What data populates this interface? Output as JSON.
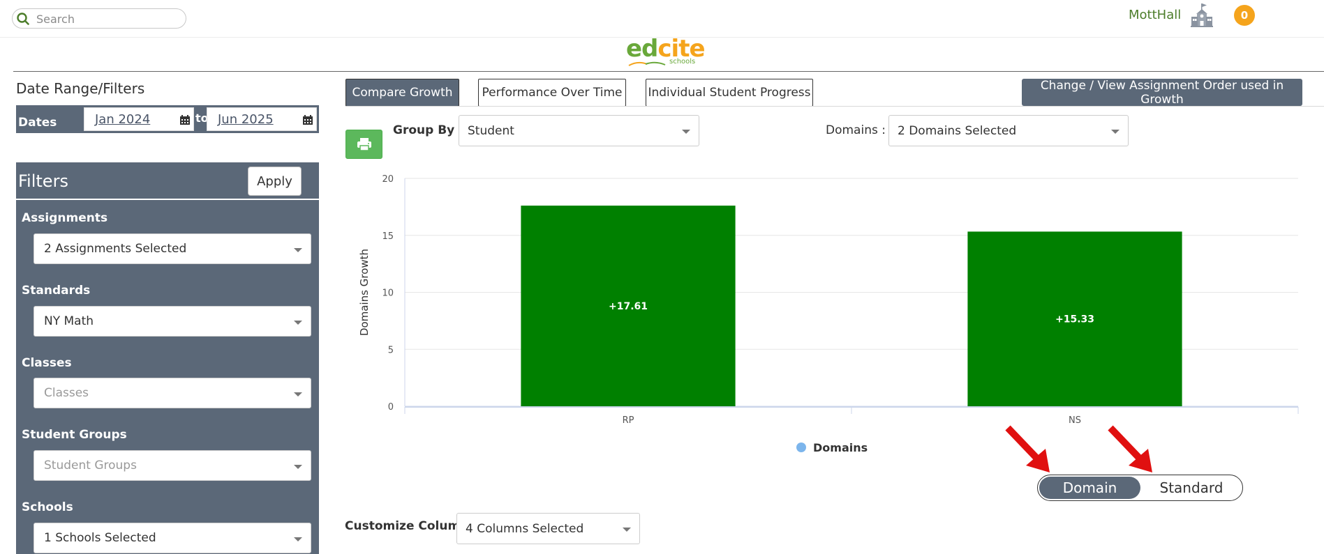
{
  "header": {
    "search_placeholder": "Search",
    "username": "MottHall",
    "notification_count": "0",
    "logo": {
      "word_left": "ed",
      "word_right": "cite",
      "sub": "schools"
    },
    "colors": {
      "brand_green": "#69a83a",
      "brand_orange": "#f5a41c"
    }
  },
  "sidebar": {
    "date_section_title": "Date Range/Filters",
    "dates_label": "Dates",
    "date_from": "Jan 2024",
    "date_to_word": "to",
    "date_to": "Jun 2025",
    "filters_title": "Filters",
    "apply_label": "Apply",
    "filters": [
      {
        "label": "Assignments",
        "value": "2 Assignments Selected",
        "placeholder": false
      },
      {
        "label": "Standards",
        "value": "NY Math",
        "placeholder": false
      },
      {
        "label": "Classes",
        "value": "Classes",
        "placeholder": true
      },
      {
        "label": "Student Groups",
        "value": "Student Groups",
        "placeholder": true
      },
      {
        "label": "Schools",
        "value": "1 Schools Selected",
        "placeholder": false
      }
    ],
    "panel_color": "#5b6878"
  },
  "main": {
    "tabs": [
      {
        "label": "Compare Growth",
        "active": true
      },
      {
        "label": "Performance Over Time",
        "active": false
      },
      {
        "label": "Individual Student Progress",
        "active": false
      }
    ],
    "order_button_label": "Change / View Assignment Order used in Growth",
    "group_by_label": "Group By :",
    "group_by_value": "Student",
    "domains_label": "Domains :",
    "domains_value": "2 Domains Selected",
    "toggle": {
      "on_label": "Domain",
      "off_label": "Standard"
    },
    "customize_label": "Customize Columns:",
    "customize_value": "4 Columns Selected"
  },
  "chart_data": {
    "type": "bar",
    "categories": [
      "RP",
      "NS"
    ],
    "series": [
      {
        "name": "Domains",
        "values": [
          17.61,
          15.33
        ],
        "data_labels": [
          "+17.61",
          "+15.33"
        ]
      }
    ],
    "title": "",
    "xlabel": "",
    "ylabel": "Domains Growth",
    "ylim": [
      0,
      20
    ],
    "yticks": [
      0,
      5,
      10,
      15,
      20
    ],
    "grid": true,
    "legend_position": "bottom",
    "bar_color": "#008000",
    "legend_color": "#7cb5ec"
  }
}
